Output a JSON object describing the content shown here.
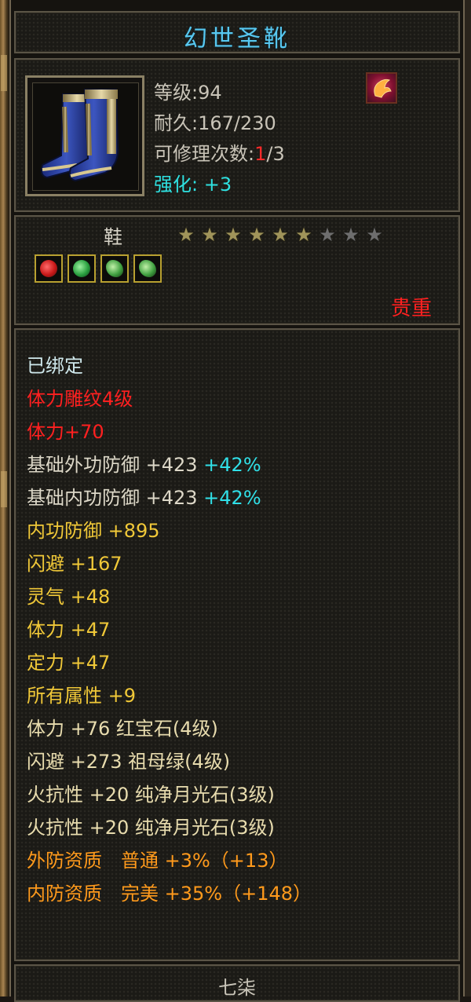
{
  "item": {
    "name": "幻世圣靴",
    "icon": "boots-icon",
    "badge_icon": "phoenix-emblem-icon",
    "level_label": "等级:",
    "level": "94",
    "durability_label": "耐久:",
    "durability": "167/230",
    "repair_label": "可修理次数:",
    "repair_used": "1",
    "repair_max": "/3",
    "enhance_label": "强化:",
    "enhance": "+3",
    "type": "鞋",
    "stars_filled": 6,
    "stars_total": 9,
    "gems": [
      "ruby-gem-icon",
      "emerald-gem-icon",
      "moonstone-gem-icon",
      "moonstone-gem-icon"
    ],
    "rarity": "贵重"
  },
  "attributes": [
    {
      "text": "已绑定",
      "color": "bound"
    },
    {
      "text": "体力雕纹4级",
      "color": "red"
    },
    {
      "text": "体力+70",
      "color": "red"
    },
    {
      "text": "基础外功防御 +423",
      "extra": " +42%",
      "color": "white"
    },
    {
      "text": "基础内功防御 +423",
      "extra": " +42%",
      "color": "white"
    },
    {
      "text": "内功防御 +895",
      "color": "gold"
    },
    {
      "text": "闪避 +167",
      "color": "gold"
    },
    {
      "text": "灵气 +48",
      "color": "gold"
    },
    {
      "text": "体力 +47",
      "color": "gold"
    },
    {
      "text": "定力 +47",
      "color": "gold"
    },
    {
      "text": "所有属性 +9",
      "color": "gold"
    },
    {
      "text": "体力 +76 红宝石(4级)",
      "color": "wgold"
    },
    {
      "text": "闪避 +273 祖母绿(4级)",
      "color": "wgold"
    },
    {
      "text": "火抗性 +20 纯净月光石(3级)",
      "color": "wgold"
    },
    {
      "text": "火抗性 +20 纯净月光石(3级)",
      "color": "wgold"
    },
    {
      "text": "外防资质　普通 +3%（+13）",
      "color": "orange"
    },
    {
      "text": "内防资质　完美 +35%（+148）",
      "color": "orange"
    }
  ],
  "footer": "七柒",
  "colors": {
    "title": "#58c8f0",
    "enhance": "#2ee0e0",
    "rarity": "#ff2020",
    "gold": "#f0c838",
    "orange": "#ff9a1c"
  }
}
